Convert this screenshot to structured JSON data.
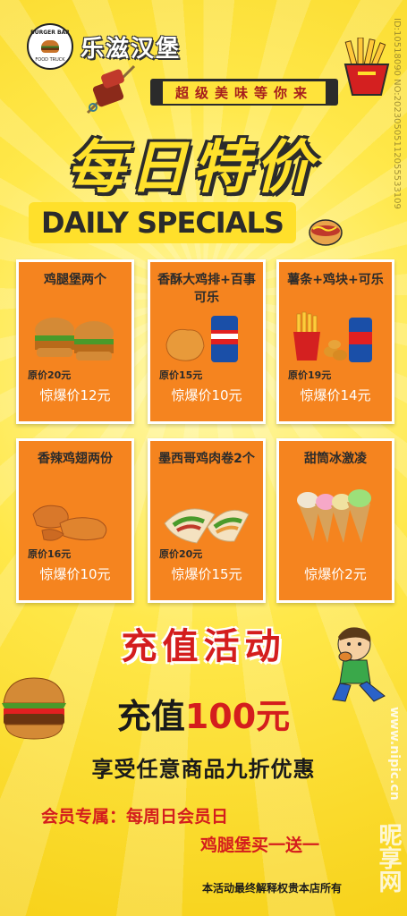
{
  "brand": {
    "name": "乐滋汉堡",
    "logo_top": "BURGER BAR",
    "logo_bottom": "FOOD TRUCK"
  },
  "watermark_id": "ID:10518090 NO:20230505112055533109",
  "tagline": "超级美味等你来",
  "title": "每日特价",
  "subtitle": "DAILY SPECIALS",
  "items": [
    {
      "name": "鸡腿堡两个",
      "original": "原价20元",
      "deal": "惊爆价12元",
      "icon": "burger-icon"
    },
    {
      "name": "香酥大鸡排+百事可乐",
      "original": "原价15元",
      "deal": "惊爆价10元",
      "icon": "chicken-cutlet-icon"
    },
    {
      "name": "薯条+鸡块+可乐",
      "original": "原价19元",
      "deal": "惊爆价14元",
      "icon": "fries-nuggets-icon"
    },
    {
      "name": "香辣鸡翅两份",
      "original": "原价16元",
      "deal": "惊爆价10元",
      "icon": "chicken-wings-icon"
    },
    {
      "name": "墨西哥鸡肉卷2个",
      "original": "原价20元",
      "deal": "惊爆价15元",
      "icon": "wrap-icon"
    },
    {
      "name": "甜筒冰激凌",
      "original": "",
      "deal": "惊爆价2元",
      "icon": "ice-cream-icon"
    }
  ],
  "promo": {
    "title": "充值活动",
    "recharge_prefix": "充值",
    "recharge_amount": "100元",
    "discount": "享受任意商品九折优惠",
    "member_label": "会员专属：",
    "member_day": "每周日会员日",
    "bogo": "鸡腿堡买一送一",
    "footer": "本活动最终解释权贵本店所有"
  },
  "site_watermark": "www.nipic.cn",
  "site_watermark_big": "昵享网",
  "colors": {
    "background": "#ffe84a",
    "card": "#f5841f",
    "accent_red": "#d41d1d",
    "dark": "#2b2b2b"
  }
}
